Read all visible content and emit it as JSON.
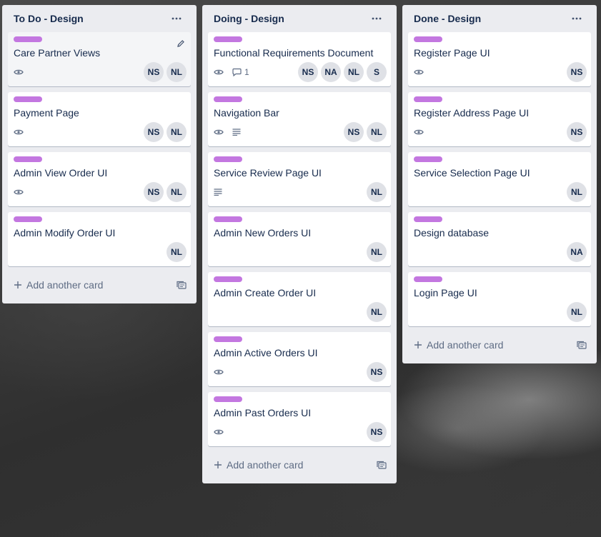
{
  "colors": {
    "label": "#c377e0"
  },
  "add_card_label": "Add another card",
  "lists": [
    {
      "title": "To Do - Design",
      "cards": [
        {
          "title": "Care Partner Views",
          "members": [
            "NS",
            "NL"
          ]
        },
        {
          "title": "Payment Page",
          "members": [
            "NS",
            "NL"
          ]
        },
        {
          "title": "Admin View Order UI",
          "members": [
            "NS",
            "NL"
          ]
        },
        {
          "title": "Admin Modify Order UI",
          "members": [
            "NL"
          ]
        }
      ]
    },
    {
      "title": "Doing - Design",
      "cards": [
        {
          "title": "Functional Requirements Document",
          "comments": "1",
          "members": [
            "NS",
            "NA",
            "NL",
            "S"
          ]
        },
        {
          "title": "Navigation Bar",
          "members": [
            "NS",
            "NL"
          ]
        },
        {
          "title": "Service Review Page UI",
          "members": [
            "NL"
          ]
        },
        {
          "title": "Admin New Orders UI",
          "members": [
            "NL"
          ]
        },
        {
          "title": "Admin Create Order UI",
          "members": [
            "NL"
          ]
        },
        {
          "title": "Admin Active Orders UI",
          "members": [
            "NS"
          ]
        },
        {
          "title": "Admin Past Orders UI",
          "members": [
            "NS"
          ]
        }
      ]
    },
    {
      "title": "Done - Design",
      "cards": [
        {
          "title": "Register Page UI",
          "members": [
            "NS"
          ]
        },
        {
          "title": "Register Address Page UI",
          "members": [
            "NS"
          ]
        },
        {
          "title": "Service Selection Page UI",
          "members": [
            "NL"
          ]
        },
        {
          "title": "Design database",
          "members": [
            "NA"
          ]
        },
        {
          "title": "Login Page UI",
          "members": [
            "NL"
          ]
        }
      ]
    }
  ]
}
